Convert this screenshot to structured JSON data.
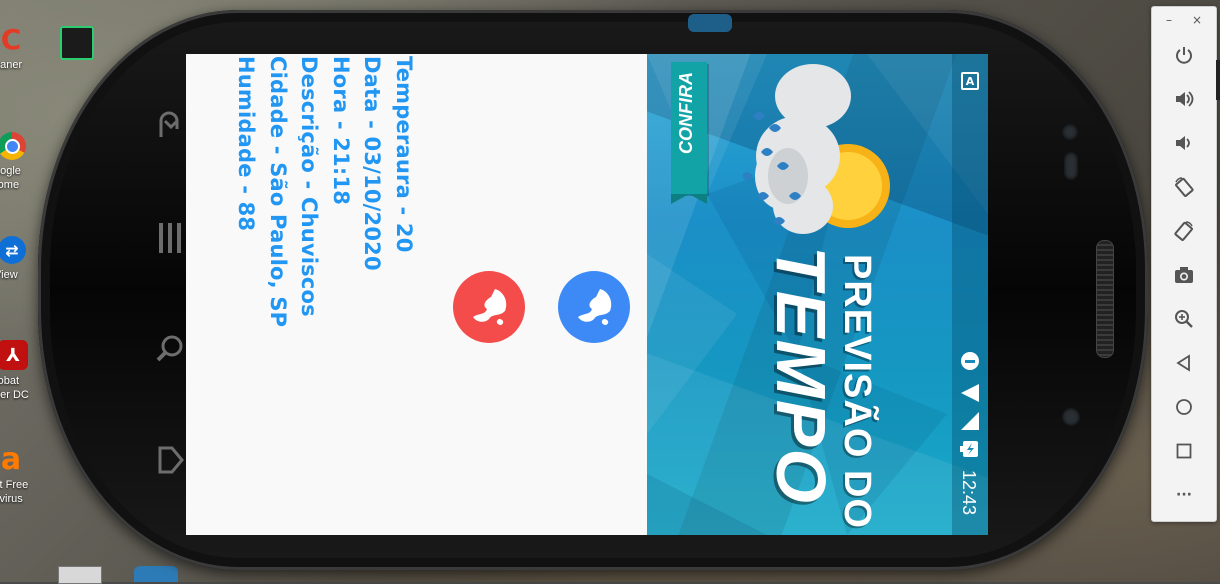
{
  "desktop": {
    "icons": [
      {
        "label": "eaner",
        "color": "#d23a2a",
        "glyph": "C"
      },
      {
        "label": "oogle\nrome",
        "color": "#ffffff",
        "glyph": "●"
      },
      {
        "label": "View",
        "color": "#0e6fd6",
        "glyph": "⇄"
      },
      {
        "label": "robat\nder DC",
        "color": "#c0100f",
        "glyph": "A"
      },
      {
        "label": "st Free\ntivirus",
        "color": "#ff7a00",
        "glyph": "a"
      }
    ]
  },
  "app": {
    "info_lines": [
      "Temperaura - 20",
      "Data - 03/10/2020",
      "Hora - 21:18",
      "Descrição - Chuviscos",
      "Cidade - São Paulo, SP",
      "Humidade - 88"
    ],
    "fab_red_color": "#f44b4b",
    "fab_blue_color": "#3d8af7",
    "text_color": "#2196f3"
  },
  "banner": {
    "badge": "CONFIRA",
    "title_line1": "PREVISÃO DO",
    "title_line2": "TEMPO",
    "teal": "#12a3a6"
  },
  "status_bar": {
    "time": "12:43",
    "notification_letter": "A"
  },
  "emulator_toolbar": {
    "minimize": "–",
    "close": "×",
    "buttons": [
      {
        "name": "power-icon",
        "glyph": "⏻"
      },
      {
        "name": "volume-up-icon",
        "glyph": "🔊"
      },
      {
        "name": "volume-down-icon",
        "glyph": "🔉"
      },
      {
        "name": "rotate-left-icon",
        "glyph": "⟲"
      },
      {
        "name": "rotate-right-icon",
        "glyph": "⟳"
      },
      {
        "name": "screenshot-icon",
        "glyph": "⌾"
      },
      {
        "name": "zoom-icon",
        "glyph": "⊕"
      },
      {
        "name": "back-icon",
        "glyph": "◁"
      },
      {
        "name": "home-icon",
        "glyph": "○"
      },
      {
        "name": "overview-icon",
        "glyph": "□"
      },
      {
        "name": "more-icon",
        "glyph": "···"
      }
    ]
  }
}
